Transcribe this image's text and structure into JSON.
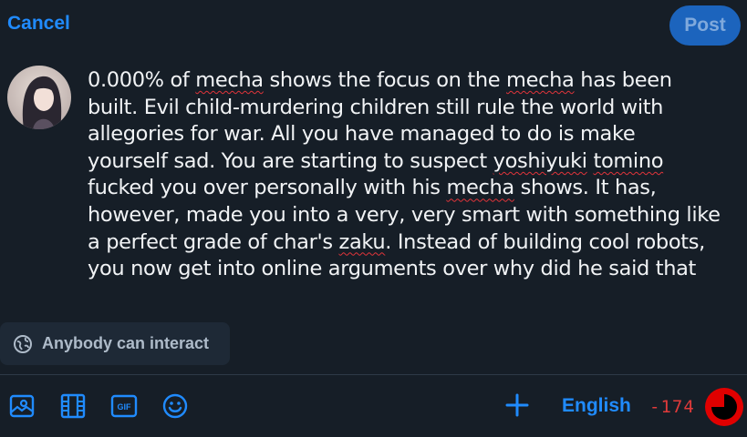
{
  "header": {
    "cancel_label": "Cancel",
    "post_label": "Post"
  },
  "composer": {
    "lines": [
      [
        {
          "t": "0.000% of "
        },
        {
          "t": "mecha",
          "s": true
        },
        {
          "t": " shows the focus on the "
        },
        {
          "t": "mecha",
          "s": true
        },
        {
          "t": " has been"
        }
      ],
      [
        {
          "t": "built. Evil child-murdering children still rule the world with"
        }
      ],
      [
        {
          "t": "allegories for war. All you have managed to do is make"
        }
      ],
      [
        {
          "t": "yourself sad. You are starting to suspect "
        },
        {
          "t": "yoshiyuki",
          "s": true
        },
        {
          "t": " "
        },
        {
          "t": "tomino",
          "s": true
        }
      ],
      [
        {
          "t": "fucked you over personally with his "
        },
        {
          "t": "mecha",
          "s": true
        },
        {
          "t": " shows. It has,"
        }
      ],
      [
        {
          "t": "however, made you into a very, very smart with something like"
        }
      ],
      [
        {
          "t": "a perfect grade of char's "
        },
        {
          "t": "zaku",
          "s": true
        },
        {
          "t": ". Instead of building cool robots,"
        }
      ],
      [
        {
          "t": "you now get into online arguments over why did he said that"
        }
      ]
    ]
  },
  "interaction": {
    "label": "Anybody can interact",
    "icon": "globe-icon"
  },
  "toolbar": {
    "icons": [
      "image-icon",
      "video-icon",
      "gif-icon",
      "emoji-icon",
      "plus-icon"
    ],
    "language": "English",
    "char_count": "-174",
    "char_limit_progress": 1.0
  },
  "colors": {
    "background": "#161e27",
    "accent": "#208bfe",
    "post_button": "#1c64bd",
    "error": "#e03a3a"
  }
}
